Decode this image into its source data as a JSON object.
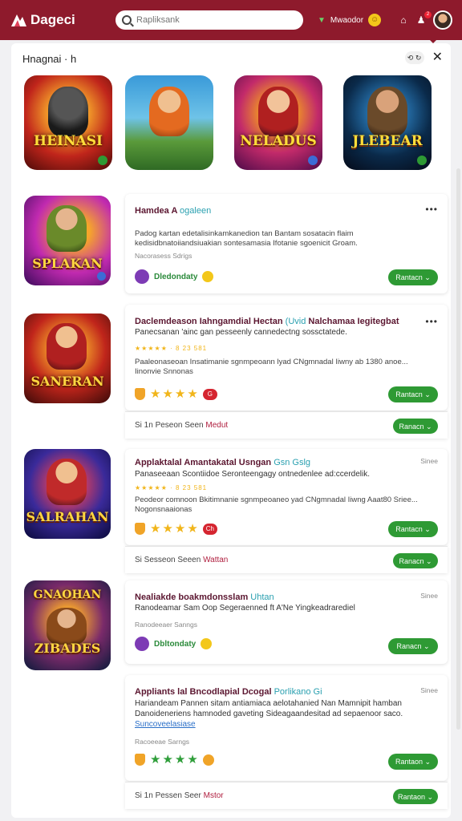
{
  "topbar": {
    "brand": "Dageci",
    "search_placeholder": "Rapliksank",
    "wallet_label": "Mwaodor",
    "notif_count": "2",
    "accent": "#8e1a2c"
  },
  "panel": {
    "title": "Hnagnai · h",
    "toggle_label": "⟲ ↻"
  },
  "featured": [
    {
      "title": "HEINASI",
      "colors": [
        "#c0251b",
        "#f07a1a"
      ],
      "badge_color": "#2e9a34"
    },
    {
      "title": "",
      "colors": [
        "#3a9ad9",
        "#8cd24c"
      ],
      "badge_color": ""
    },
    {
      "title": "NELADUS",
      "colors": [
        "#a21a8c",
        "#f5a21c"
      ],
      "badge_color": "#3c6bd6"
    },
    {
      "title": "JLEBEAR",
      "colors": [
        "#0a2a4a",
        "#2a7ab8"
      ],
      "badge_color": "#2e9a34"
    }
  ],
  "cards": [
    {
      "image_title": "SPLAKAN",
      "title": "Hamdea A ",
      "tag": "ogaleen ",
      "desc": "Padog kartan edetalisinkamkanedion tan Bantam sosatacin flaim kedisidbnatoiiandsiuakian sontesamasia Ifotanie sgoenicit Groam.",
      "meta": "Nacorasess Sdrigs",
      "developer": "Dledondaty",
      "install": "Rantacn ⌄"
    },
    {
      "image_title": "SANERAN",
      "title": "Daclemdeason Iahngamdial Hectan ",
      "tag": "(Uvid ",
      "title2": "Nalchamaa Iegitegbat",
      "sub": "Panecsanan 'ainc gan pesseenly cannedectng sossctatede.",
      "rating_text": "★★★★★ · 8 23 581",
      "desc": "Paaleonaseoan Insatimanie sgnmpeoann lyad CNgmnadal Iiwny ab 1380 anoe... Iinonvie Snnonas",
      "rating_badge": "G",
      "install": "Rantacn ⌄",
      "foot": "Si 1n Peseon Seen ",
      "foot_red": "Medut",
      "foot_install": "Ranacn ⌄"
    },
    {
      "image_title": "SALRAHAN",
      "title": "Applaktalal Amantakatal Usngan ",
      "tag": "Gsn Gslg",
      "time": "Sinee",
      "sub": "Panaseeaan Scontiidoe Seronteengagy ontnedenlee ad:ccerdelik.",
      "rating_text": "★★★★★ · 8 23 581",
      "desc": "Peodeor comnoon Bkitimnanie sgnmpeoaneo yad CNgmnadal Iiwng Aaat80 Sriee... Nogonsnaaionas",
      "rating_badge": "Ch",
      "install": "Rantacn ⌄",
      "foot": "Si Sesseon Seeen ",
      "foot_red": "Wattan",
      "foot_install": "Ranacn ⌄"
    },
    {
      "image_title": "ZIBADES",
      "image_title2": "GNAOHAN",
      "title": "Nealiakde boakmdonsslam ",
      "tag": "Uhtan",
      "time": "Sinee",
      "sub": "Ranodeamar Sam Oop Segeraenned ft A'Ne Yingkeadrarediel",
      "meta": "Ranodeeaer Sanngs",
      "developer": "Dbltondaty",
      "install": "Ranacn ⌄"
    },
    {
      "image_title": "",
      "title": "Appliants lal Bncodlapial Dcogal ",
      "tag": "Porlikano Gi",
      "time": "Sinee",
      "desc": "Hariandeam Pannen sitam antiamiaca aelotahanied Nan Mamnipit hamban Danoideneriens hamnoded gaveting Sideagaandesitad ad sepaenoor saco. ",
      "link": "Suncoveelasiase",
      "meta": "Racoeeae Sarngs",
      "install": "Rantaon ⌄",
      "foot": "Si 1n Pessen Seer ",
      "foot_red": "Mstor",
      "foot_install": "Rantaon ⌄"
    }
  ]
}
